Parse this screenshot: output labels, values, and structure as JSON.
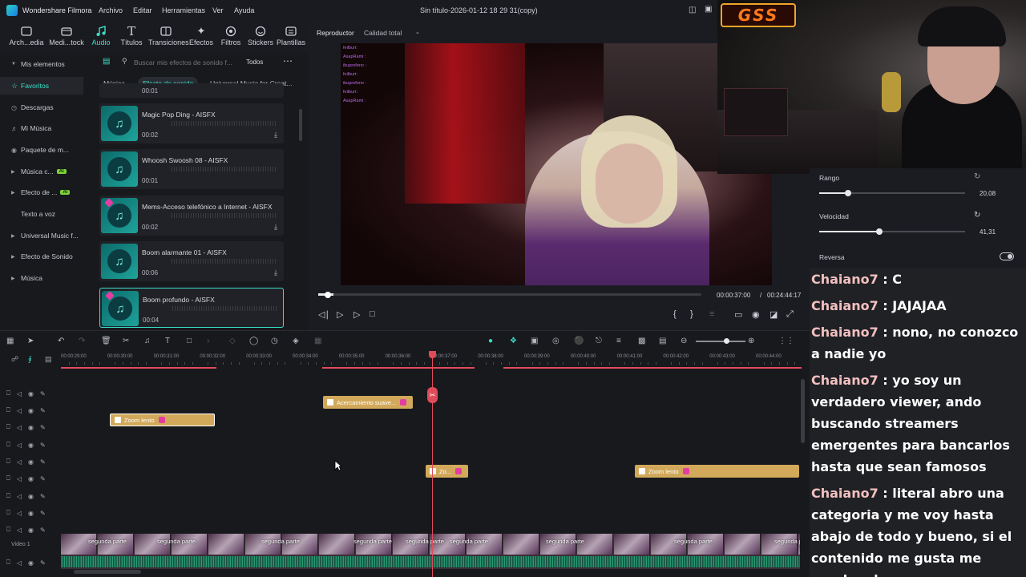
{
  "app": {
    "name": "Wondershare Filmora",
    "menus": [
      "Archivo",
      "Editar",
      "Herramientas",
      "Ver",
      "Ayuda"
    ],
    "doc_title": "Sin título-2026-01-12 18 29 31(copy)"
  },
  "toolbar": {
    "items": [
      {
        "label": "Arch...edia",
        "icon": "media-icon"
      },
      {
        "label": "Medi...tock",
        "icon": "stock-media-icon"
      },
      {
        "label": "Audio",
        "icon": "music-note-icon"
      },
      {
        "label": "Títulos",
        "icon": "text-icon"
      },
      {
        "label": "Transiciones",
        "icon": "transition-icon"
      },
      {
        "label": "Efectos",
        "icon": "effects-icon"
      },
      {
        "label": "Filtros",
        "icon": "filter-icon"
      },
      {
        "label": "Stickers",
        "icon": "sticker-icon"
      },
      {
        "label": "Plantillas",
        "icon": "template-icon"
      }
    ],
    "active": "Audio"
  },
  "sidebar": {
    "items": [
      {
        "label": "Mis elementos",
        "arrow": true
      },
      {
        "label": "Favoritos",
        "icon": "star-icon"
      },
      {
        "label": "Descargas",
        "icon": "clock-icon"
      },
      {
        "label": "Mi Música",
        "icon": "music-icon"
      },
      {
        "label": "Paquete de m...",
        "icon": "package-icon"
      },
      {
        "label": "Música c...",
        "arrow": true,
        "ai": "AI"
      },
      {
        "label": "Efecto de ...",
        "arrow": true,
        "ai": "AI"
      },
      {
        "label": "Texto a voz"
      },
      {
        "label": "Universal Music f...",
        "arrow": true
      },
      {
        "label": "Efecto de Sonido",
        "arrow": true
      },
      {
        "label": "Música",
        "arrow": true
      }
    ]
  },
  "search": {
    "placeholder": "Buscar mis efectos de sonido f...",
    "filter": "Todos"
  },
  "subtabs": [
    "Música",
    "Efecto de sonido",
    "Universal Music for Creat..."
  ],
  "sounds": [
    {
      "name": "Magic Pop Ding - AISFX",
      "duration": "00:02"
    },
    {
      "name": "Whoosh Swoosh 08 - AISFX",
      "duration": "00:01"
    },
    {
      "name": "Mems-Acceso telefónico a Internet - AISFX",
      "duration": "00:02"
    },
    {
      "name": "Boom alarmante 01 - AISFX",
      "duration": "00:06"
    },
    {
      "name": "Boom profundo - AISFX",
      "duration": "00:04"
    }
  ],
  "partial_top_duration": "00:01",
  "player": {
    "tab": "Reproductor",
    "quality": "Calidad total",
    "current_time": "00:00:37:00",
    "total_time": "00:24:44:17",
    "progress": 0.04,
    "chat_overlay": [
      "feilburt :",
      "AsapRami :",
      "ibuprefeno :",
      "feilburt :",
      "ibuprefeno :",
      "feilburt :",
      "AsapRami :"
    ]
  },
  "properties": {
    "range_label": "Rango",
    "range_value": "20,08",
    "range_fraction": 0.2,
    "speed_label": "Velocidad",
    "speed_value": "41,31",
    "speed_fraction": 0.41,
    "reverse_label": "Reversa"
  },
  "overlay_logo": "GSS",
  "chat": [
    {
      "user": "Chaiano7",
      "text": " : C"
    },
    {
      "user": "Chaiano7",
      "text": " : JAJAJAA"
    },
    {
      "user": "Chaiano7",
      "text": " : nono, no conozco a nadie yo"
    },
    {
      "user": "Chaiano7",
      "text": " : yo soy un verdadero viewer, ando buscando streamers emergentes para bancarlos hasta que sean famosos"
    },
    {
      "user": "Chaiano7",
      "text": " : literal abro una categoria y me voy hasta abajo de todo y bueno, si el contenido me gusta me quedo a bancar"
    }
  ],
  "timeline": {
    "ticks": [
      "00:00:29:00",
      "00:00:30:00",
      "00:00:31:00",
      "00:00:32:00",
      "00:00:33:00",
      "00:00:34:00",
      "00:00:35:00",
      "00:00:36:00",
      "00:00:37:00",
      "00:00:38:00",
      "00:00:39:00",
      "00:00:40:00",
      "00:00:41:00",
      "00:00:42:00",
      "00:00:43:00",
      "00:00:44:00"
    ],
    "clips": [
      {
        "label": "Acercamiento suave..."
      },
      {
        "label": "Zoom lento"
      },
      {
        "label": "Zo..."
      },
      {
        "label": "Zoom lento"
      }
    ],
    "video_track_label": "Video 1",
    "video_clip_label": "segunda parte"
  }
}
